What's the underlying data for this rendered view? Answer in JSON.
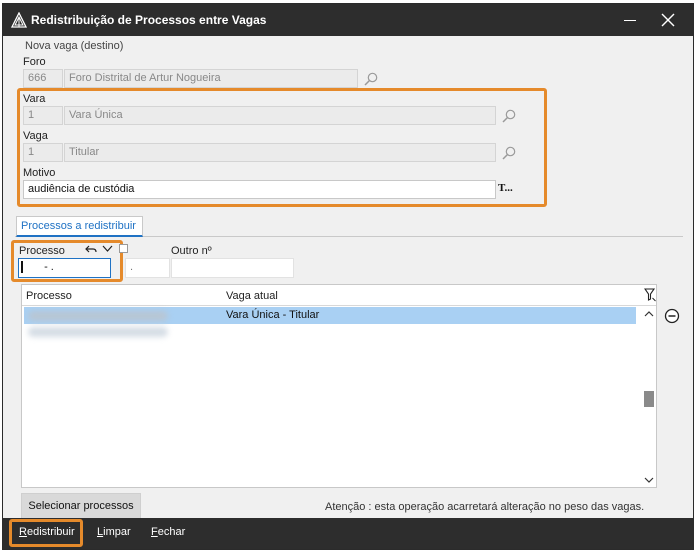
{
  "window": {
    "title": "Redistribuição de Processos entre Vagas"
  },
  "destino": {
    "group_title": "Nova vaga (destino)",
    "foro": {
      "label": "Foro",
      "code": "666",
      "name": "Foro Distrital de Artur Nogueira"
    },
    "vara": {
      "label": "Vara",
      "code": "1",
      "name": "Vara Única"
    },
    "vaga": {
      "label": "Vaga",
      "code": "1",
      "name": "Titular"
    },
    "motivo": {
      "label": "Motivo",
      "value": "audiência de custódia",
      "button_label": "T..."
    }
  },
  "tabs": [
    {
      "label": "Processos a redistribuir",
      "active": true
    }
  ],
  "processo": {
    "label": "Processo",
    "mask": "-  .",
    "mask2": ".",
    "outro_label": "Outro nº"
  },
  "grid": {
    "columns": [
      "Processo",
      "Vaga atual"
    ],
    "rows": [
      {
        "processo": "",
        "vaga_atual": "Vara Única - Titular"
      }
    ]
  },
  "actions": {
    "select_label": "Selecionar processos",
    "warning": "Atenção : esta operação acarretará alteração no peso das vagas."
  },
  "footer": {
    "redistribuir": {
      "underline": "R",
      "rest": "edistribuir"
    },
    "limpar": {
      "underline": "L",
      "rest": "impar"
    },
    "fechar": {
      "underline": "F",
      "rest": "echar"
    }
  },
  "colors": {
    "accent": "#e58a2b",
    "tab_blue": "#1f72c4",
    "selected_row": "#a9d0f3",
    "titlebar": "#2d2d2d"
  }
}
